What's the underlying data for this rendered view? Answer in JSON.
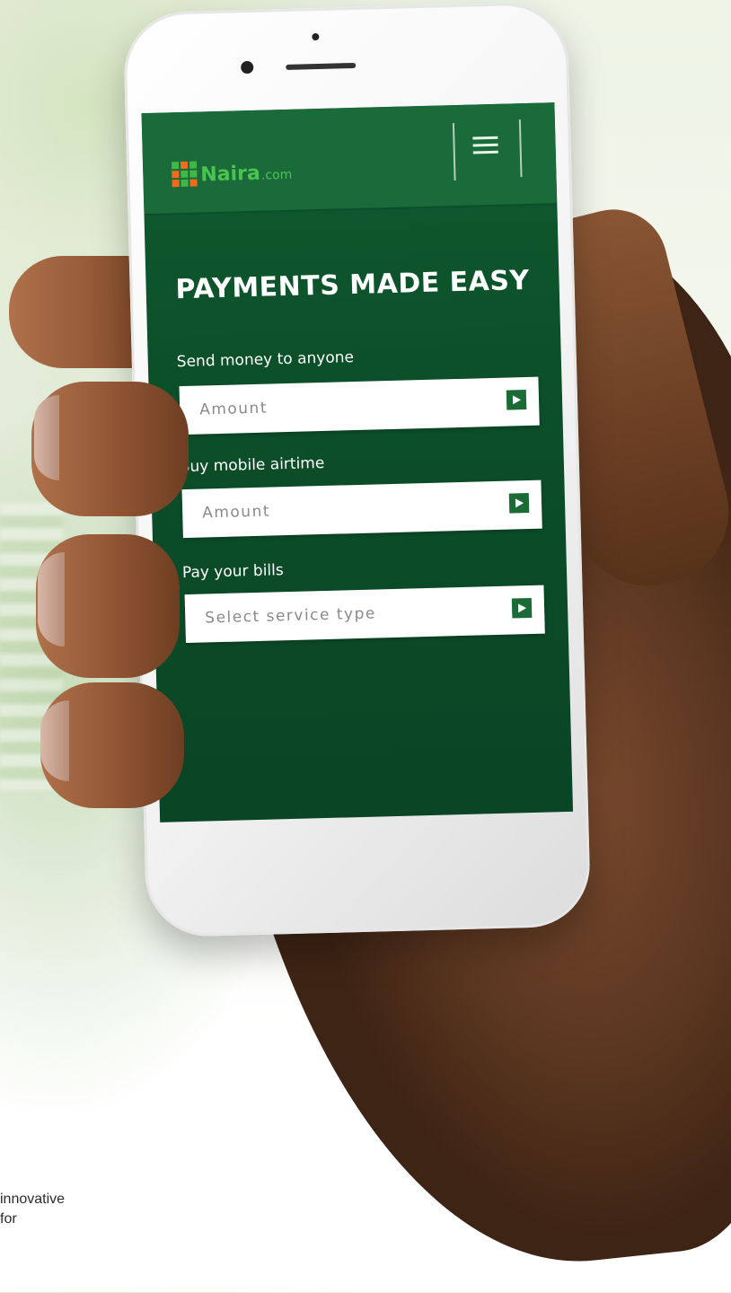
{
  "app": {
    "brand_word": "Naira",
    "brand_domain": ".com",
    "brand_mark_colors": [
      "#3fb846",
      "#f26a1b",
      "#3fb846",
      "#f26a1b",
      "#3fb846",
      "#3fb846",
      "#f26a1b",
      "#3fb846",
      "#f26a1b"
    ]
  },
  "header": {
    "menu_icon": "hamburger-icon"
  },
  "main": {
    "title": "PAYMENTS MADE EASY",
    "sections": [
      {
        "label": "Send money to anyone",
        "placeholder": "Amount",
        "action_icon": "play-arrow-icon"
      },
      {
        "label": "Buy mobile airtime",
        "placeholder": "Amount",
        "action_icon": "play-arrow-icon"
      },
      {
        "label": "Pay your bills",
        "placeholder": "Select service type",
        "action_icon": "play-arrow-icon"
      }
    ]
  },
  "caption": {
    "line1": "innovative",
    "line2": "for"
  },
  "colors": {
    "screen_green": "#0c4f29",
    "header_green": "#1b6a3a",
    "brand_green": "#49c54f",
    "button_green": "#1a6b35"
  }
}
